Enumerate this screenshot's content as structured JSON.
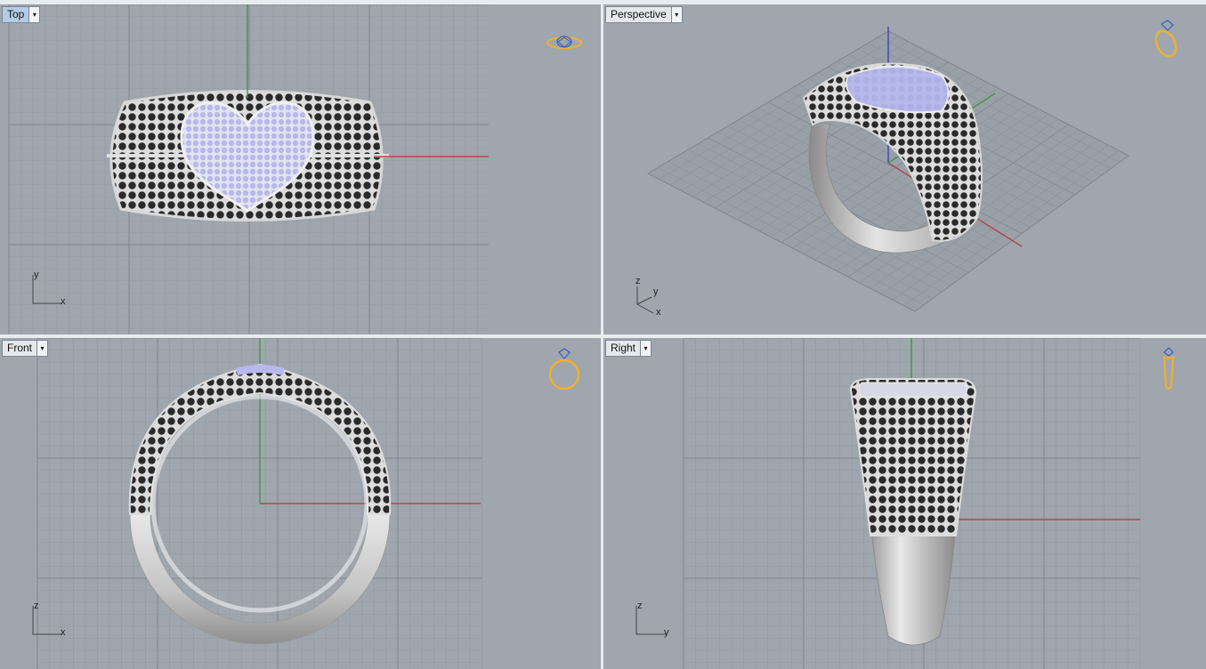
{
  "viewports": [
    {
      "id": "top",
      "label": "Top",
      "active": true,
      "axes": [
        "y",
        "x"
      ]
    },
    {
      "id": "perspective",
      "label": "Perspective",
      "active": false,
      "axes": [
        "z",
        "y",
        "x"
      ]
    },
    {
      "id": "front",
      "label": "Front",
      "active": false,
      "axes": [
        "z",
        "x"
      ]
    },
    {
      "id": "right",
      "label": "Right",
      "active": false,
      "axes": [
        "z",
        "y"
      ]
    }
  ],
  "dropdown_glyph": "▾",
  "colors": {
    "background": "#a0a6ae",
    "grid_minor": "#939aa2",
    "grid_major": "#7f868e",
    "axis_x": "#b04848",
    "axis_y": "#3c9a3c",
    "axis_z": "#4040b8",
    "metal": "#c8c8c8",
    "stone_black": "#2a2a2a",
    "stone_lavender": "#b6b8ee",
    "widget": "#f0b030"
  },
  "icons": {
    "top": "ring-top-widget-icon",
    "perspective": "ring-perspective-widget-icon",
    "front": "ring-front-widget-icon",
    "right": "ring-side-widget-icon"
  }
}
